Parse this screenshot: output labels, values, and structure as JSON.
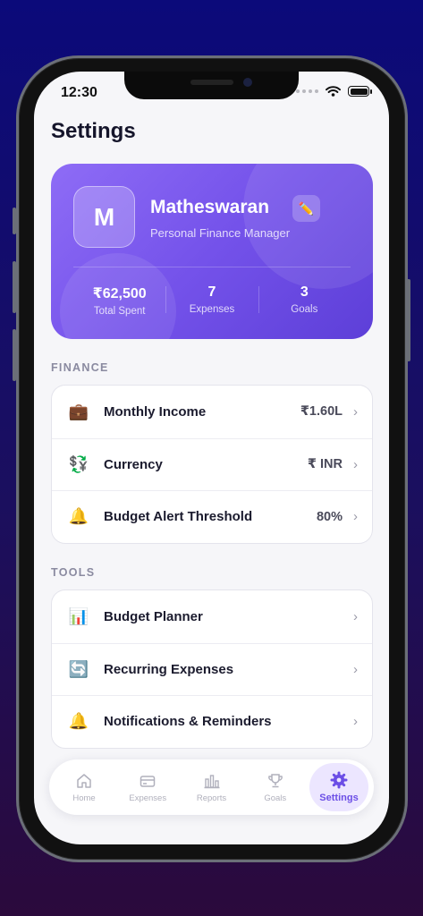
{
  "status": {
    "time": "12:30"
  },
  "page": {
    "title": "Settings"
  },
  "profile": {
    "initial": "M",
    "name": "Matheswaran",
    "role": "Personal Finance Manager",
    "edit_icon": "✏️",
    "stats": [
      {
        "value": "₹62,500",
        "label": "Total Spent"
      },
      {
        "value": "7",
        "label": "Expenses"
      },
      {
        "value": "3",
        "label": "Goals"
      }
    ]
  },
  "finance": {
    "label": "FINANCE",
    "items": [
      {
        "icon": "💼",
        "label": "Monthly Income",
        "value": "₹1.60L"
      },
      {
        "icon": "💱",
        "label": "Currency",
        "value": "₹ INR"
      },
      {
        "icon": "🔔",
        "label": "Budget Alert Threshold",
        "value": "80%"
      }
    ]
  },
  "tools": {
    "label": "TOOLS",
    "items": [
      {
        "icon": "📊",
        "label": "Budget Planner"
      },
      {
        "icon": "🔄",
        "label": "Recurring Expenses"
      },
      {
        "icon": "🔔",
        "label": "Notifications & Reminders"
      }
    ]
  },
  "tabs": [
    {
      "label": "Home"
    },
    {
      "label": "Expenses"
    },
    {
      "label": "Reports"
    },
    {
      "label": "Goals"
    },
    {
      "label": "Settings",
      "active": true
    }
  ],
  "colors": {
    "accent": "#6b4ee6",
    "card_gradient_start": "#8e6cf6",
    "card_gradient_end": "#5d3fd8"
  }
}
